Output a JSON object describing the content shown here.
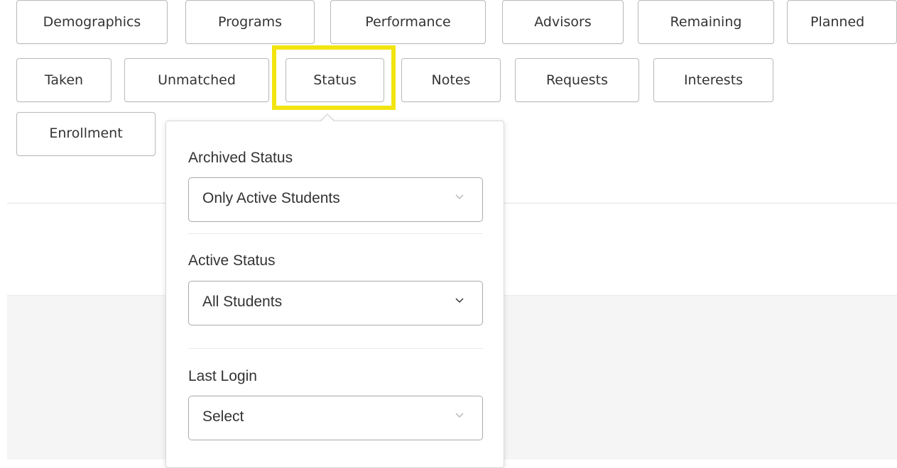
{
  "filter_buttons": {
    "row1": [
      "Demographics",
      "Programs",
      "Performance",
      "Advisors",
      "Remaining",
      "Planned"
    ],
    "row2": [
      "Taken",
      "Unmatched",
      "Status",
      "Notes",
      "Requests",
      "Interests"
    ],
    "row3": [
      "Enrollment"
    ]
  },
  "highlight_color": "#f2e40e",
  "status_panel": {
    "archived_status": {
      "label": "Archived Status",
      "value": "Only Active Students"
    },
    "active_status": {
      "label": "Active Status",
      "value": "All Students"
    },
    "last_login": {
      "label": "Last Login",
      "value": "Select"
    }
  }
}
